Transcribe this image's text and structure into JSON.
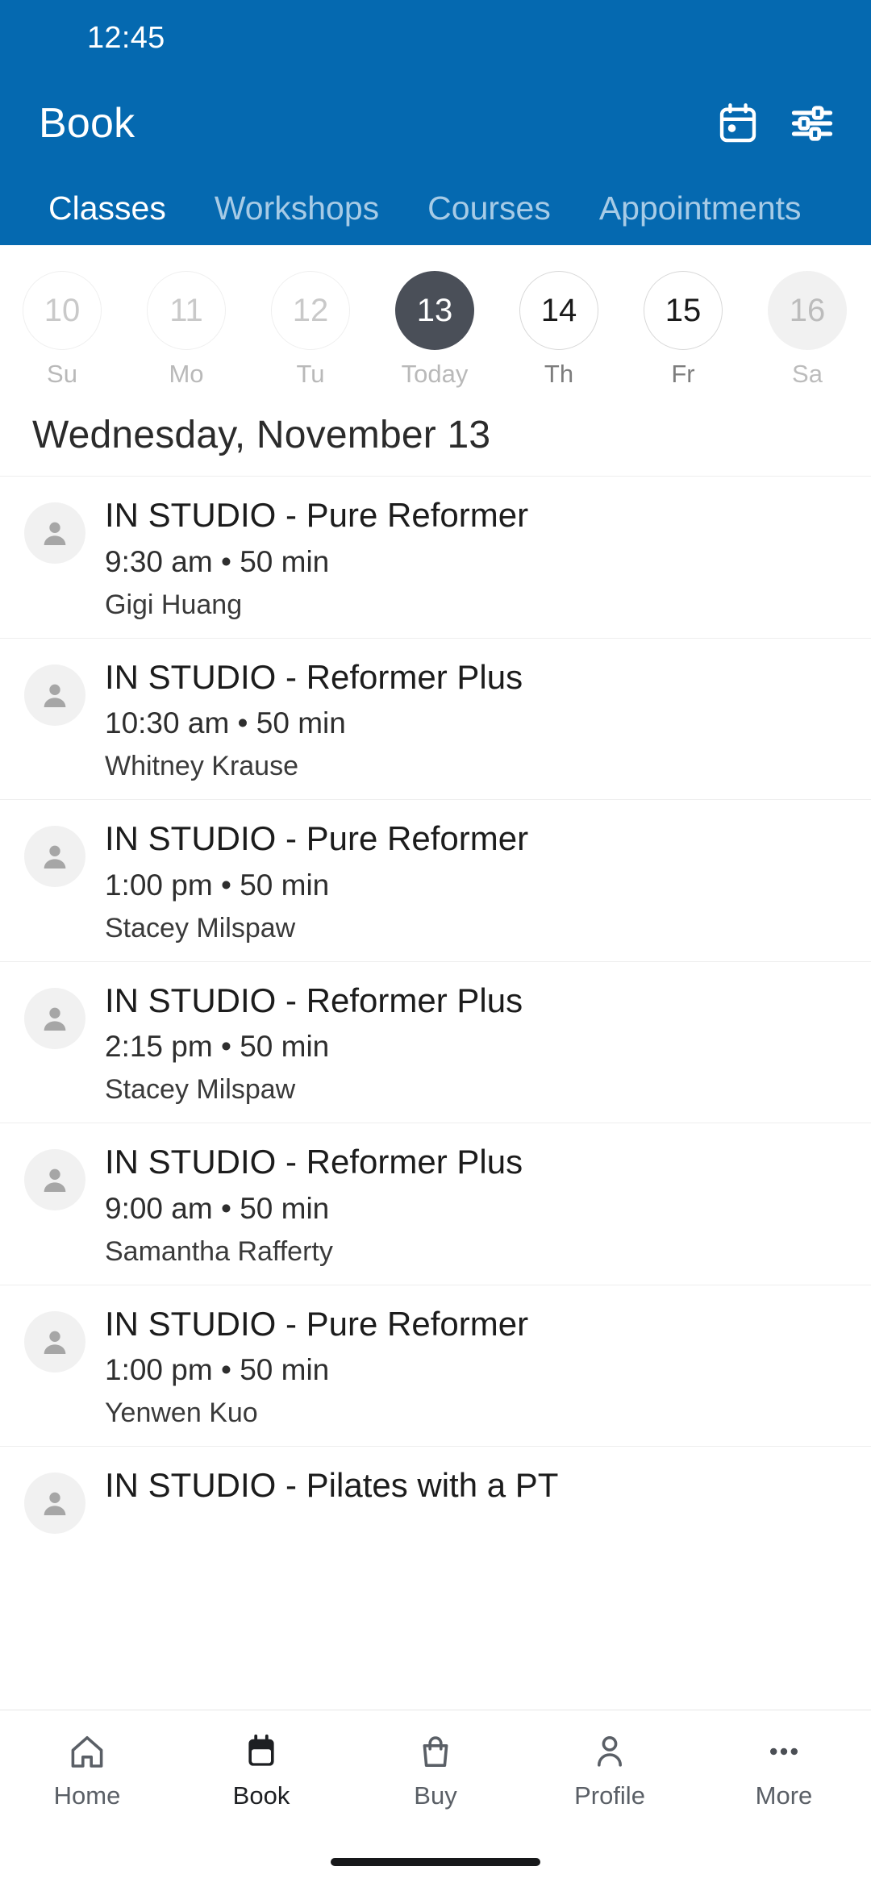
{
  "status_bar": {
    "clock": "12:45"
  },
  "app_bar": {
    "title": "Book",
    "calendar_icon": "calendar-icon",
    "filter_icon": "filter-sliders-icon"
  },
  "tabs": {
    "active": "Classes",
    "items": [
      {
        "label": "Classes"
      },
      {
        "label": "Workshops"
      },
      {
        "label": "Courses"
      },
      {
        "label": "Appointments"
      }
    ]
  },
  "date_strip": {
    "days": [
      {
        "date": "10",
        "weekday": "Su",
        "state": "past"
      },
      {
        "date": "11",
        "weekday": "Mo",
        "state": "past"
      },
      {
        "date": "12",
        "weekday": "Tu",
        "state": "past"
      },
      {
        "date": "13",
        "weekday": "Today",
        "state": "selected"
      },
      {
        "date": "14",
        "weekday": "Th",
        "state": "avail"
      },
      {
        "date": "15",
        "weekday": "Fr",
        "state": "avail"
      },
      {
        "date": "16",
        "weekday": "Sa",
        "state": "muted"
      }
    ]
  },
  "section": {
    "date_heading": "Wednesday, November 13"
  },
  "classes": [
    {
      "title": "IN STUDIO - Pure Reformer",
      "meta": "9:30 am • 50 min",
      "teacher": "Gigi Huang",
      "avatar": "person-placeholder-icon"
    },
    {
      "title": "IN STUDIO - Reformer Plus",
      "meta": "10:30 am • 50 min",
      "teacher": "Whitney Krause",
      "avatar": "person-placeholder-icon"
    },
    {
      "title": "IN STUDIO - Pure Reformer",
      "meta": "1:00 pm • 50 min",
      "teacher": "Stacey Milspaw",
      "avatar": "person-placeholder-icon"
    },
    {
      "title": "IN STUDIO - Reformer Plus",
      "meta": "2:15 pm • 50 min",
      "teacher": "Stacey Milspaw",
      "avatar": "person-placeholder-icon"
    },
    {
      "title": "IN STUDIO - Reformer Plus",
      "meta": "9:00 am • 50 min",
      "teacher": "Samantha Rafferty",
      "avatar": "person-placeholder-icon"
    },
    {
      "title": "IN STUDIO - Pure Reformer",
      "meta": "1:00 pm • 50 min",
      "teacher": "Yenwen Kuo",
      "avatar": "person-placeholder-icon"
    },
    {
      "title": "IN STUDIO - Pilates with a PT",
      "meta": "",
      "teacher": "",
      "avatar": "person-placeholder-icon"
    }
  ],
  "bottom_nav": {
    "active": "Book",
    "items": [
      {
        "label": "Home",
        "icon": "home-icon"
      },
      {
        "label": "Book",
        "icon": "calendar-filled-icon"
      },
      {
        "label": "Buy",
        "icon": "shopping-bag-icon"
      },
      {
        "label": "Profile",
        "icon": "person-icon"
      },
      {
        "label": "More",
        "icon": "more-dots-icon"
      }
    ]
  },
  "colors": {
    "brand_blue": "#0569b0",
    "tab_inactive": "#a7cbe6",
    "selected_day": "#4a4f58",
    "muted_day_bg": "#f1f1f1",
    "text_primary": "#1c1c1c",
    "divider": "#eeeeee"
  }
}
